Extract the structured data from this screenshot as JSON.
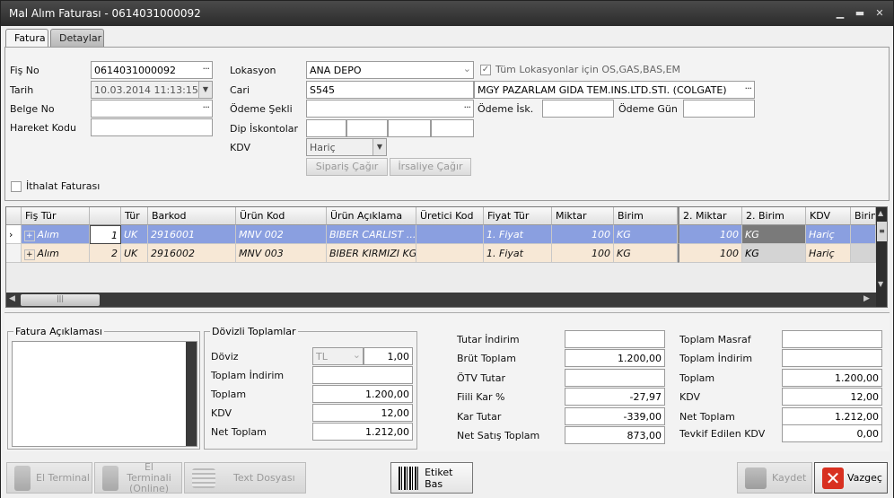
{
  "window": {
    "title": "Mal Alım Faturası - 0614031000092"
  },
  "tabs": [
    {
      "label": "Fatura"
    },
    {
      "label": "Detaylar"
    }
  ],
  "header": {
    "fis_no": {
      "label": "Fiş No",
      "value": "0614031000092"
    },
    "tarih": {
      "label": "Tarih",
      "value": "10.03.2014 11:13:15"
    },
    "belge_no": {
      "label": "Belge No",
      "value": ""
    },
    "hareket_kodu": {
      "label": "Hareket Kodu",
      "value": ""
    },
    "lokasyon": {
      "label": "Lokasyon",
      "value": "ANA DEPO"
    },
    "cari": {
      "label": "Cari",
      "code": "S545",
      "name": "MGY PAZARLAM GIDA TEM.INS.LTD.STI. (COLGATE)"
    },
    "odeme_sekli": {
      "label": "Ödeme Şekli",
      "value": ""
    },
    "dip_iskontolar": {
      "label": "Dip İskontolar"
    },
    "kdv": {
      "label": "KDV",
      "value": "Hariç"
    },
    "tum_lokasyonlar": {
      "label": "Tüm Lokasyonlar için OS,GAS,BAS,EM",
      "checked": true
    },
    "odeme_isk": {
      "label": "Ödeme İsk.",
      "value": ""
    },
    "odeme_gun": {
      "label": "Ödeme Gün",
      "value": ""
    },
    "siparis_cagir": "Sipariş Çağır",
    "irsaliye_cagir": "İrsaliye Çağır",
    "ithalat": {
      "label": "İthalat Faturası",
      "checked": false
    }
  },
  "grid": {
    "columns": [
      "Fiş Tür",
      "",
      "Tür",
      "Barkod",
      "Ürün Kod",
      "Ürün Açıklama",
      "Üretici Kod",
      "Fiyat Tür",
      "Miktar",
      "Birim",
      "2. Miktar",
      "2. Birim",
      "KDV",
      "Birim"
    ],
    "rows": [
      {
        "fis_tur": "Alım",
        "no": "1",
        "tur": "UK",
        "barkod": "2916001",
        "urun_kod": "MNV 002",
        "aciklama": "BIBER CARLIST ...",
        "uretici": "",
        "fiyat_tur": "1. Fiyat",
        "miktar": "100",
        "birim": "KG",
        "miktar2": "100",
        "birim2": "KG",
        "kdv": "Hariç"
      },
      {
        "fis_tur": "Alım",
        "no": "2",
        "tur": "UK",
        "barkod": "2916002",
        "urun_kod": "MNV 003",
        "aciklama": "BIBER KIRMIZI KG",
        "uretici": "",
        "fiyat_tur": "1. Fiyat",
        "miktar": "100",
        "birim": "KG",
        "miktar2": "100",
        "birim2": "KG",
        "kdv": "Hariç"
      }
    ]
  },
  "aciklama": {
    "title": "Fatura Açıklaması",
    "value": ""
  },
  "dovizli": {
    "title": "Dövizli Toplamlar",
    "doviz_label": "Döviz",
    "doviz_currency": "TL",
    "doviz_rate": "1,00",
    "toplam_indirim_label": "Toplam İndirim",
    "toplam_indirim": "",
    "toplam_label": "Toplam",
    "toplam": "1.200,00",
    "kdv_label": "KDV",
    "kdv": "12,00",
    "net_toplam_label": "Net Toplam",
    "net_toplam": "1.212,00"
  },
  "mid": [
    {
      "label": "Tutar İndirim",
      "value": ""
    },
    {
      "label": "Brüt Toplam",
      "value": "1.200,00"
    },
    {
      "label": "ÖTV Tutar",
      "value": ""
    },
    {
      "label": "Fiili Kar %",
      "value": "-27,97"
    },
    {
      "label": "Kar Tutar",
      "value": "-339,00"
    },
    {
      "label": "Net Satış Toplam",
      "value": "873,00"
    }
  ],
  "right": [
    {
      "label": "Toplam Masraf",
      "value": ""
    },
    {
      "label": "Toplam İndirim",
      "value": ""
    },
    {
      "label": "Toplam",
      "value": "1.200,00"
    },
    {
      "label": "KDV",
      "value": "12,00"
    },
    {
      "label": "Net Toplam",
      "value": "1.212,00"
    },
    {
      "label": "Tevkif Edilen KDV",
      "value": "0,00"
    }
  ],
  "footer": {
    "el_terminal": "El Terminal",
    "el_terminal_online": "El Terminali (Online)",
    "text_dosyasi": "Text Dosyası",
    "etiket_bas": "Etiket Bas",
    "kaydet": "Kaydet",
    "vazgec": "Vazgeç"
  },
  "colors": {
    "selected_row": "#8a9fe0",
    "alt_row": "#f7e8d6",
    "titlebar": "#2b2b2b",
    "cancel_red": "#d83020"
  }
}
